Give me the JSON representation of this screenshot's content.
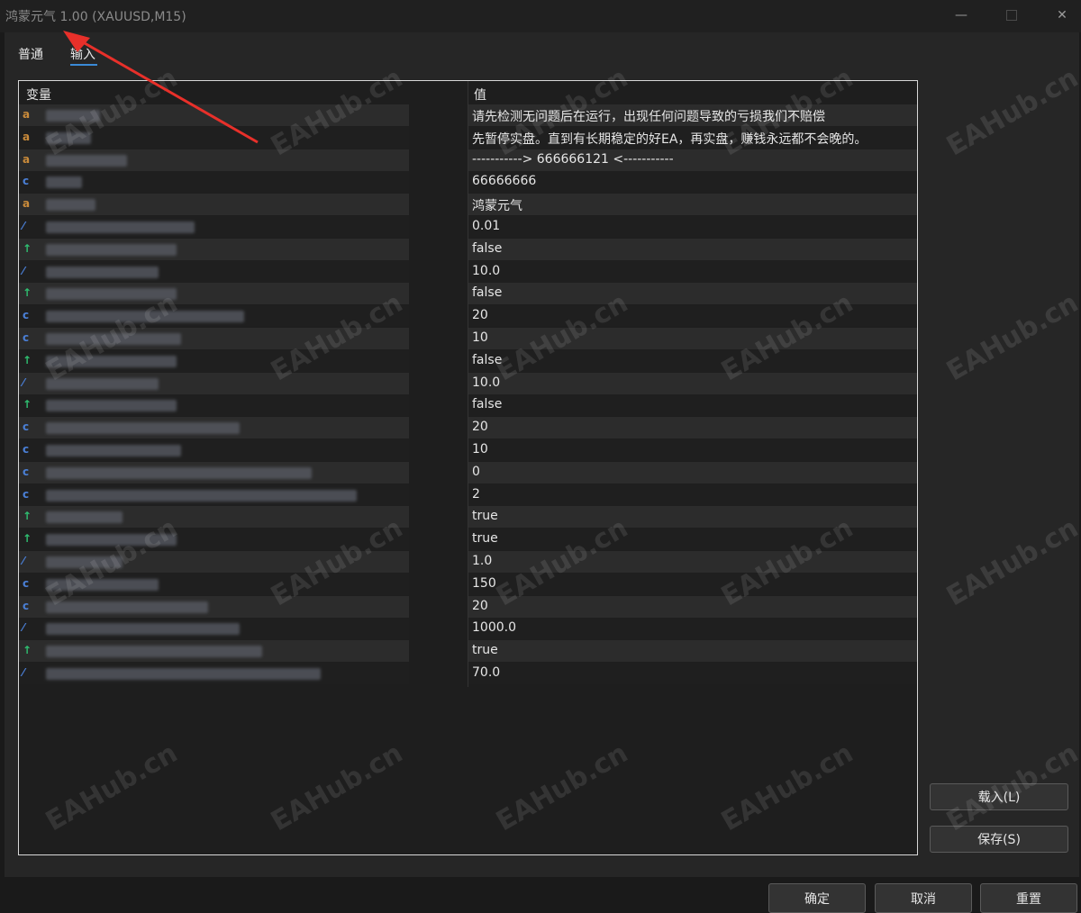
{
  "window": {
    "title": "鸿蒙元气 1.00 (XAUUSD,M15)",
    "controls": {
      "minimize": "—",
      "close": "✕"
    }
  },
  "tabs": [
    {
      "label": "普通",
      "active": false
    },
    {
      "label": "输入",
      "active": true
    }
  ],
  "grid": {
    "headers": {
      "name": "变量",
      "value": "值"
    },
    "rows": [
      {
        "type": "a",
        "value": "请先检测无问题后在运行，出现任何问题导致的亏损我们不赔偿"
      },
      {
        "type": "a",
        "value": "先暂停实盘。直到有长期稳定的好EA，再实盘，赚钱永远都不会晚的。"
      },
      {
        "type": "a",
        "value": "-----------> 666666121 <-----------"
      },
      {
        "type": "int",
        "value": "66666666"
      },
      {
        "type": "a",
        "value": "鸿蒙元气"
      },
      {
        "type": "double",
        "value": "0.01"
      },
      {
        "type": "bool",
        "value": "false"
      },
      {
        "type": "double",
        "value": "10.0"
      },
      {
        "type": "bool",
        "value": "false"
      },
      {
        "type": "int",
        "value": "20"
      },
      {
        "type": "int",
        "value": "10"
      },
      {
        "type": "bool",
        "value": "false"
      },
      {
        "type": "double",
        "value": "10.0"
      },
      {
        "type": "bool",
        "value": "false"
      },
      {
        "type": "int",
        "value": "20"
      },
      {
        "type": "int",
        "value": "10"
      },
      {
        "type": "int",
        "value": "0"
      },
      {
        "type": "int",
        "value": "2"
      },
      {
        "type": "bool",
        "value": "true"
      },
      {
        "type": "bool",
        "value": "true"
      },
      {
        "type": "double",
        "value": "1.0"
      },
      {
        "type": "int",
        "value": "150"
      },
      {
        "type": "int",
        "value": "20"
      },
      {
        "type": "double",
        "value": "1000.0"
      },
      {
        "type": "bool",
        "value": "true"
      },
      {
        "type": "double",
        "value": "70.0"
      }
    ]
  },
  "buttons": {
    "load": "载入(L)",
    "save": "保存(S)",
    "ok": "确定",
    "cancel": "取消",
    "reset": "重置"
  },
  "watermark": "EAHub.cn",
  "colors": {
    "type_string": "#c98a3a",
    "type_int": "#4a7fd6",
    "type_bool": "#2fbf71",
    "type_double": "#4a7fd6",
    "annotation_arrow": "#e8302a",
    "tab_underline": "#3a8ad6"
  }
}
